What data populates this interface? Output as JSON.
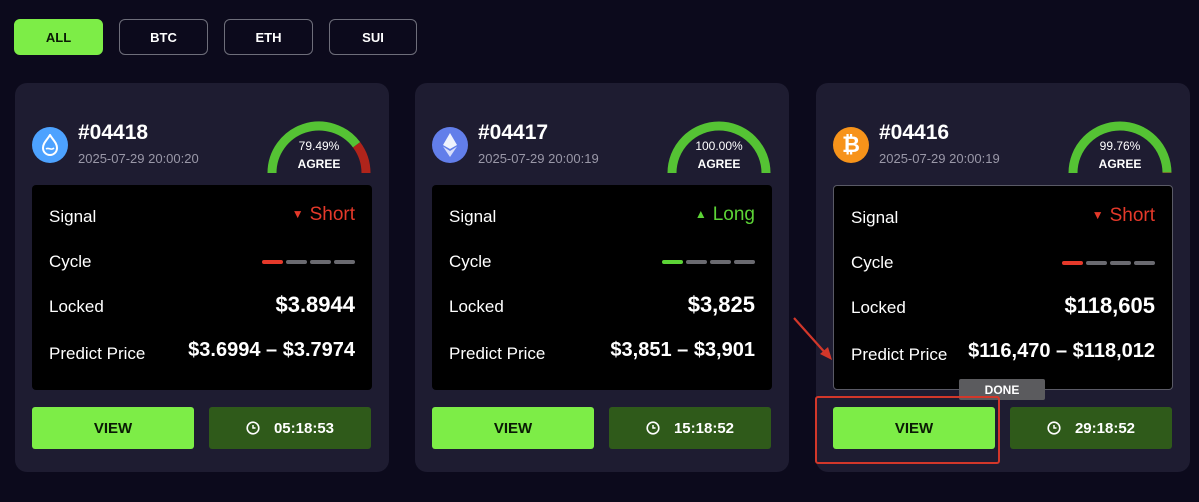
{
  "filters": [
    {
      "label": "ALL",
      "active": true
    },
    {
      "label": "BTC",
      "active": false
    },
    {
      "label": "ETH",
      "active": false
    },
    {
      "label": "SUI",
      "active": false
    }
  ],
  "cards": [
    {
      "coin": "SUI",
      "coin_color": "#4da2ff",
      "icon": "sui-icon",
      "id": "#04418",
      "timestamp": "2025-07-29 20:00:20",
      "agree_pct_text": "79.49%",
      "agree_value": 79.49,
      "agree_label": "AGREE",
      "signal_label": "Signal",
      "signal_value": "Short",
      "signal_direction": "short",
      "cycle_label": "Cycle",
      "cycle_active_index": 0,
      "cycle_active_color": "#e5392a",
      "locked_label": "Locked",
      "locked_value": "$3.8944",
      "predict_label": "Predict Price",
      "predict_value": "$3.6994 – $3.7974",
      "view_label": "VIEW",
      "timer": "05:18:53"
    },
    {
      "coin": "ETH",
      "coin_color": "#627eea",
      "icon": "eth-icon",
      "id": "#04417",
      "timestamp": "2025-07-29 20:00:19",
      "agree_pct_text": "100.00%",
      "agree_value": 100,
      "agree_label": "AGREE",
      "signal_label": "Signal",
      "signal_value": "Long",
      "signal_direction": "long",
      "cycle_label": "Cycle",
      "cycle_active_index": 0,
      "cycle_active_color": "#5cd336",
      "locked_label": "Locked",
      "locked_value": "$3,825",
      "predict_label": "Predict Price",
      "predict_value": "$3,851 – $3,901",
      "view_label": "VIEW",
      "timer": "15:18:52"
    },
    {
      "coin": "BTC",
      "coin_color": "#f7931a",
      "icon": "btc-icon",
      "id": "#04416",
      "timestamp": "2025-07-29 20:00:19",
      "agree_pct_text": "99.76%",
      "agree_value": 99.76,
      "agree_label": "AGREE",
      "signal_label": "Signal",
      "signal_value": "Short",
      "signal_direction": "short",
      "cycle_label": "Cycle",
      "cycle_active_index": 0,
      "cycle_active_color": "#e5392a",
      "locked_label": "Locked",
      "locked_value": "$118,605",
      "predict_label": "Predict Price",
      "predict_value": "$116,470 – $118,012",
      "view_label": "VIEW",
      "timer": "29:18:52"
    }
  ],
  "tooltip": {
    "label": "DONE"
  },
  "colors": {
    "accent_green": "#7ded47",
    "timer_bg": "#2f5a1a",
    "short_red": "#e5392a",
    "long_green": "#5cd336",
    "gauge_green": "#55c334",
    "gauge_red": "#b0241b",
    "annotation_red": "#d2372a"
  }
}
